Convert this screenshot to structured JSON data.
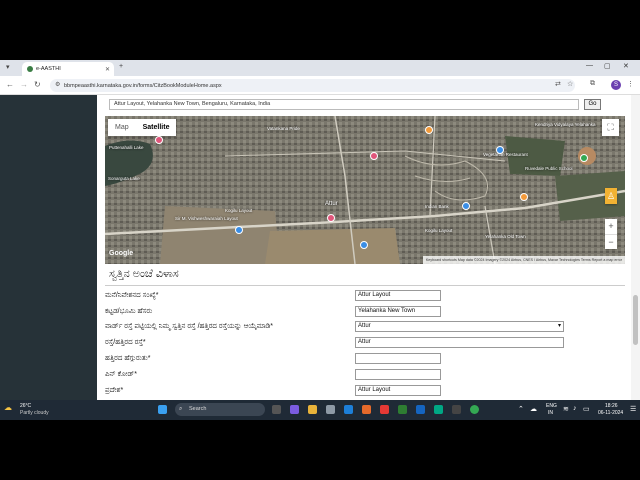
{
  "browser": {
    "tab_title": "e-AASTHI",
    "url": "bbmpeaasthi.karnataka.gov.in/forms/CitzBookModuleHome.aspx"
  },
  "search": {
    "address_value": "Attur Layout, Yelahanka New Town, Bengaluru, Karnataka, India",
    "go_label": "Go"
  },
  "map": {
    "type_map": "Map",
    "type_satellite": "Satellite",
    "logo": "Google",
    "attribution": "Keyboard shortcuts  Map data ©2024 Imagery ©2024 Airbus, CNES / Airbus, Maxar Technologies  Terms  Report a map error",
    "labels": [
      "Vatankana Pride",
      "Puttenahalli Lake",
      "Sonarguta Lake",
      "Attur",
      "Kendriya Vidyalaya Yelahanka",
      "Vegetarian Restaurant",
      "Indian Bank",
      "Kogilu Layout",
      "Sir M. Vishweshwaraiah Layout",
      "Kogilu Layout",
      "Yelahanka Old Town",
      "Ruvedale Public School"
    ]
  },
  "form": {
    "title": "ಸ್ವತ್ತಿನ ಅಂಚೆ ವಿಳಾಸ",
    "fields": [
      {
        "label": "ಮನೆ/ನಿವೇಶನದ ಸಂಖ್ಯೆ*",
        "value": "Attur Layout"
      },
      {
        "label": "ಕಟ್ಟಡ/ಭೂಮಿ ಹೆಸರು",
        "value": "Yelahanka New Town"
      },
      {
        "label": "ವಾರ್ಡ್ ರಸ್ತೆ ಪಟ್ಟಿಯಲ್ಲಿ ನಿಮ್ಮ ಸ್ವತ್ತಿನ ರಸ್ತೆ /ಹತ್ತಿರದ ರಸ್ತೆಯನ್ನು ಆಯ್ಕೆಮಾಡಿ*",
        "value": "Attur"
      },
      {
        "label": "ರಸ್ತೆ/ಹತ್ತಿರದ ರಸ್ತೆ*",
        "value": "Attur"
      },
      {
        "label": "ಹತ್ತಿರದ ಹೆಗ್ಗುರುತು*",
        "value": ""
      },
      {
        "label": "ಪಿನ್ ಕೋಡ್*",
        "value": ""
      },
      {
        "label": "ಪ್ರದೇಶ*",
        "value": "Attur Layout"
      }
    ]
  },
  "taskbar": {
    "weather_temp": "26°C",
    "weather_desc": "Partly cloudy",
    "search_placeholder": "Search",
    "lang_top": "ENG",
    "lang_bottom": "IN",
    "time": "18:26",
    "date": "06-11-2024"
  },
  "colors": {
    "sidebar": "#263238",
    "taskbar": "#1f2a36",
    "map_base": "#6e6b60"
  }
}
